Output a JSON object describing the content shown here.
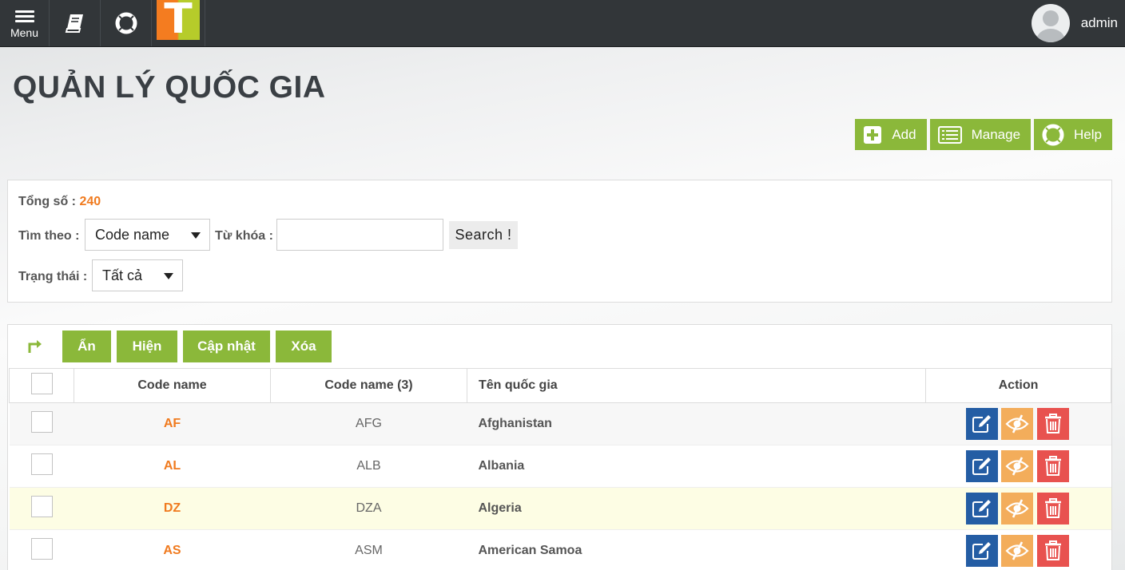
{
  "topbar": {
    "menu_label": "Menu",
    "logo_letter": "T",
    "username": "admin"
  },
  "page": {
    "title": "QUẢN LÝ QUỐC GIA"
  },
  "actions": {
    "add": "Add",
    "manage": "Manage",
    "help": "Help"
  },
  "filter": {
    "total_label": "Tổng số :",
    "total_value": "240",
    "search_by_label": "Tìm theo :",
    "search_by_value": "Code name",
    "keyword_label": "Từ khóa :",
    "keyword_value": "",
    "search_button": "Search !",
    "status_label": "Trạng thái :",
    "status_value": "Tất cả"
  },
  "bulk": {
    "hide": "Ẩn",
    "show": "Hiện",
    "update": "Cập nhật",
    "delete": "Xóa"
  },
  "table": {
    "headers": {
      "code": "Code name",
      "code3": "Code name (3)",
      "name": "Tên quốc gia",
      "action": "Action"
    },
    "rows": [
      {
        "code": "AF",
        "code3": "AFG",
        "name": "Afghanistan"
      },
      {
        "code": "AL",
        "code3": "ALB",
        "name": "Albania"
      },
      {
        "code": "DZ",
        "code3": "DZA",
        "name": "Algeria"
      },
      {
        "code": "AS",
        "code3": "ASM",
        "name": "American Samoa"
      }
    ]
  },
  "colors": {
    "topbar": "#323639",
    "accent_green": "#8bb83a",
    "accent_orange": "#f07a1e",
    "edit_blue": "#245da4",
    "hide_orange": "#f3ad5b",
    "delete_red": "#e8524f",
    "row_highlight": "#fdfde4"
  },
  "icons": [
    "hamburger-icon",
    "book-icon",
    "lifebuoy-icon",
    "avatar-icon",
    "plus-icon",
    "list-icon",
    "lifebuoy-icon",
    "chevron-down-icon",
    "corner-arrow-icon",
    "edit-icon",
    "eye-slash-icon",
    "trash-icon"
  ]
}
